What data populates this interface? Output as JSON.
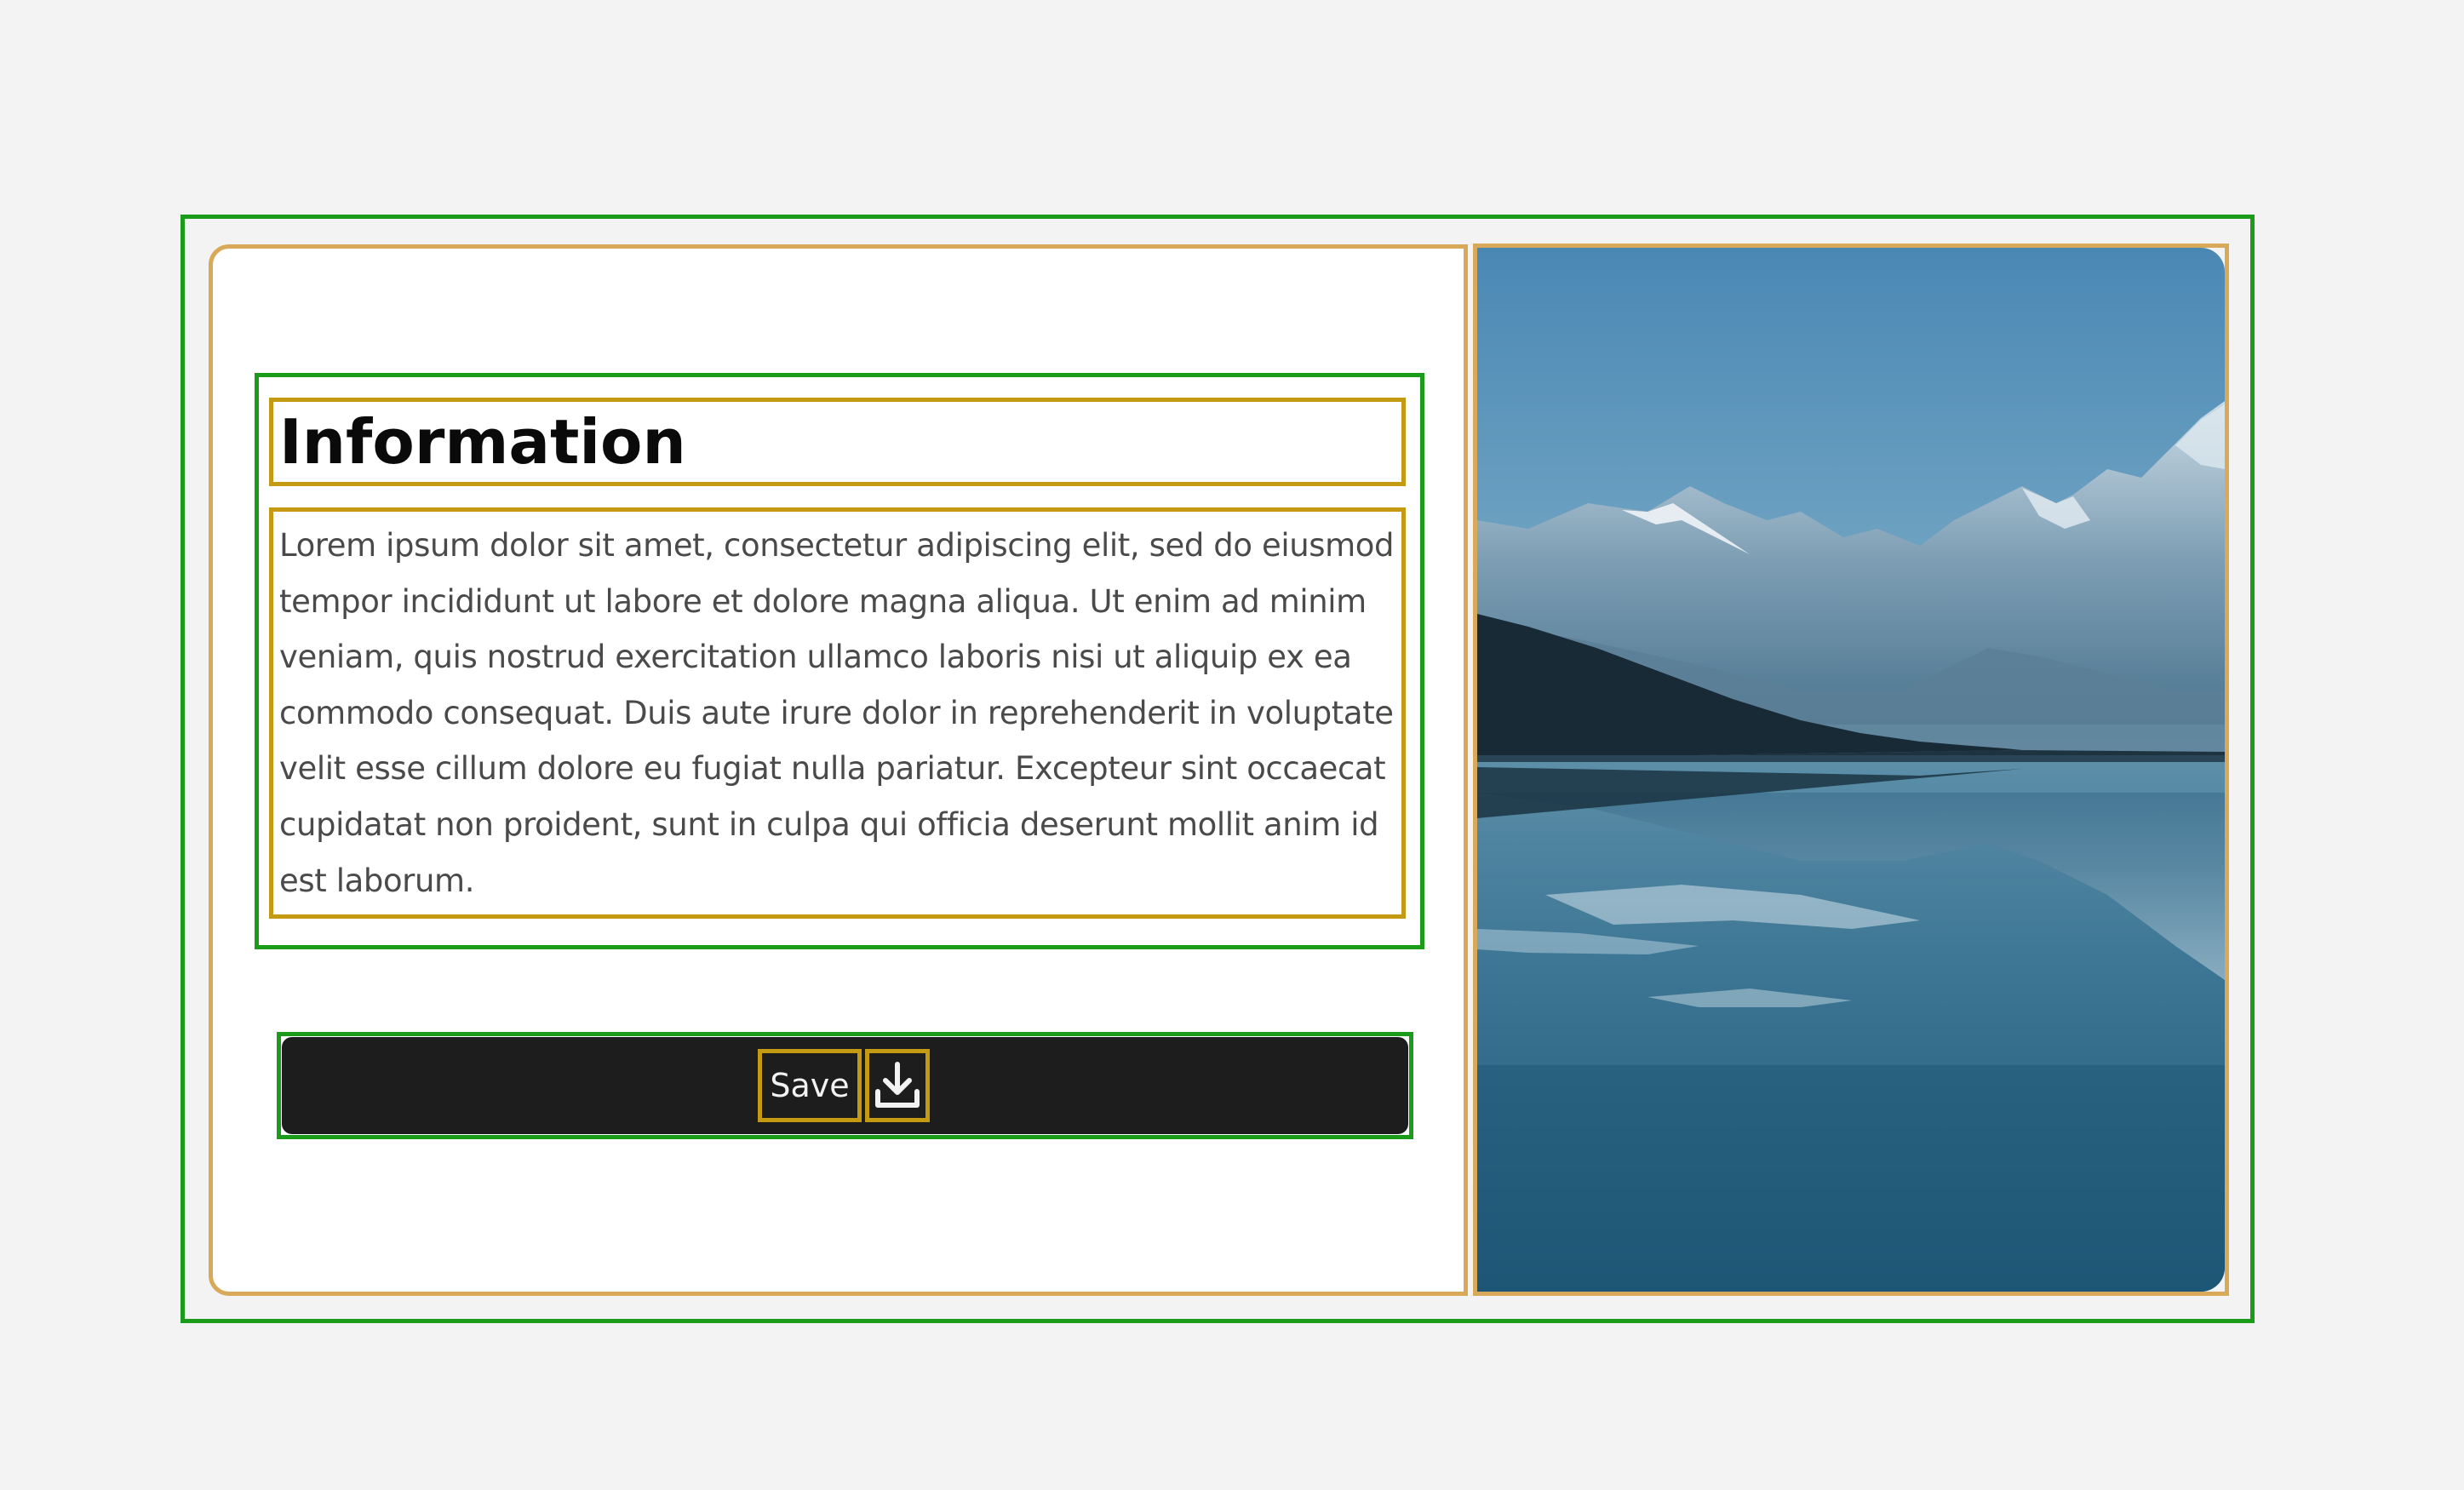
{
  "card": {
    "heading": "Information",
    "body": "Lorem ipsum dolor sit amet, consectetur adipiscing elit, sed do eiusmod tempor incididunt ut labore et dolore magna aliqua. Ut enim ad minim veniam, quis nostrud exercitation ullamco laboris nisi ut aliquip ex ea commodo consequat. Duis aute irure dolor in reprehenderit in voluptate velit esse cillum dolore eu fugiat nulla pariatur. Excepteur sint occaecat cupidatat non proident, sunt in culpa qui officia deserunt mollit anim id est laborum."
  },
  "button": {
    "label": "Save",
    "icon": "download-icon"
  },
  "image": {
    "subject": "mountain-lake"
  },
  "colors": {
    "page_background": "#f3f3f3",
    "card_background": "#ffffff",
    "button_background": "#1d1d1d",
    "button_text": "#f2f2f2",
    "heading_text": "#0a0a0a",
    "body_text": "#4a4a4a",
    "outline_green": "#1a9c1a",
    "outline_gold": "#c49a12",
    "outline_tan": "#d9a95a"
  }
}
